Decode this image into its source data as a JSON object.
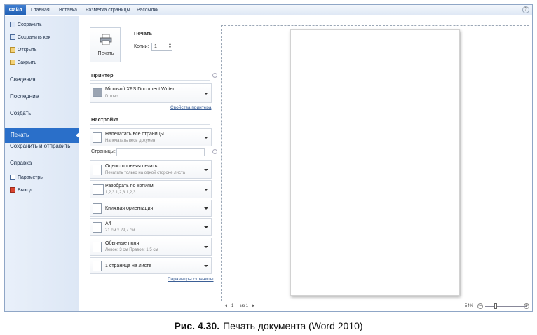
{
  "ribbon": {
    "tabs": [
      "Файл",
      "Главная",
      "Вставка",
      "Разметка страницы",
      "Рассылки"
    ]
  },
  "sidebar": {
    "top_items": [
      "Сохранить",
      "Сохранить как",
      "Открыть",
      "Закрыть"
    ],
    "sections": [
      "Сведения",
      "Последние",
      "Создать",
      "Печать",
      "Сохранить и отправить",
      "Справка"
    ],
    "bottom_items": [
      "Параметры",
      "Выход"
    ]
  },
  "print": {
    "heading": "Печать",
    "button_label": "Печать",
    "copies_label": "Копии:",
    "copies_value": "1"
  },
  "printer": {
    "heading": "Принтер",
    "name": "Microsoft XPS Document Writer",
    "status": "Готово",
    "properties_link": "Свойства принтера"
  },
  "settings": {
    "heading": "Настройка",
    "pages_label": "Страницы:",
    "options": [
      {
        "title": "Напечатать все страницы",
        "subtitle": "Напечатать весь документ"
      },
      {
        "title": "Односторонняя печать",
        "subtitle": "Печатать только на одной стороне листа"
      },
      {
        "title": "Разобрать по копиям",
        "subtitle": "1,2,3    1,2,3    1,2,3"
      },
      {
        "title": "Книжная ориентация",
        "subtitle": ""
      },
      {
        "title": "A4",
        "subtitle": "21 см x 29,7 см"
      },
      {
        "title": "Обычные поля",
        "subtitle": "Левое: 3 см    Правое: 1,5 см"
      },
      {
        "title": "1 страница на листе",
        "subtitle": ""
      }
    ],
    "page_setup_link": "Параметры страницы"
  },
  "statusbar": {
    "page_current": "1",
    "page_of": "из 1",
    "zoom": "54%"
  },
  "caption": {
    "bold": "Рис. 4.30.",
    "text": "Печать документа (Word 2010)"
  }
}
